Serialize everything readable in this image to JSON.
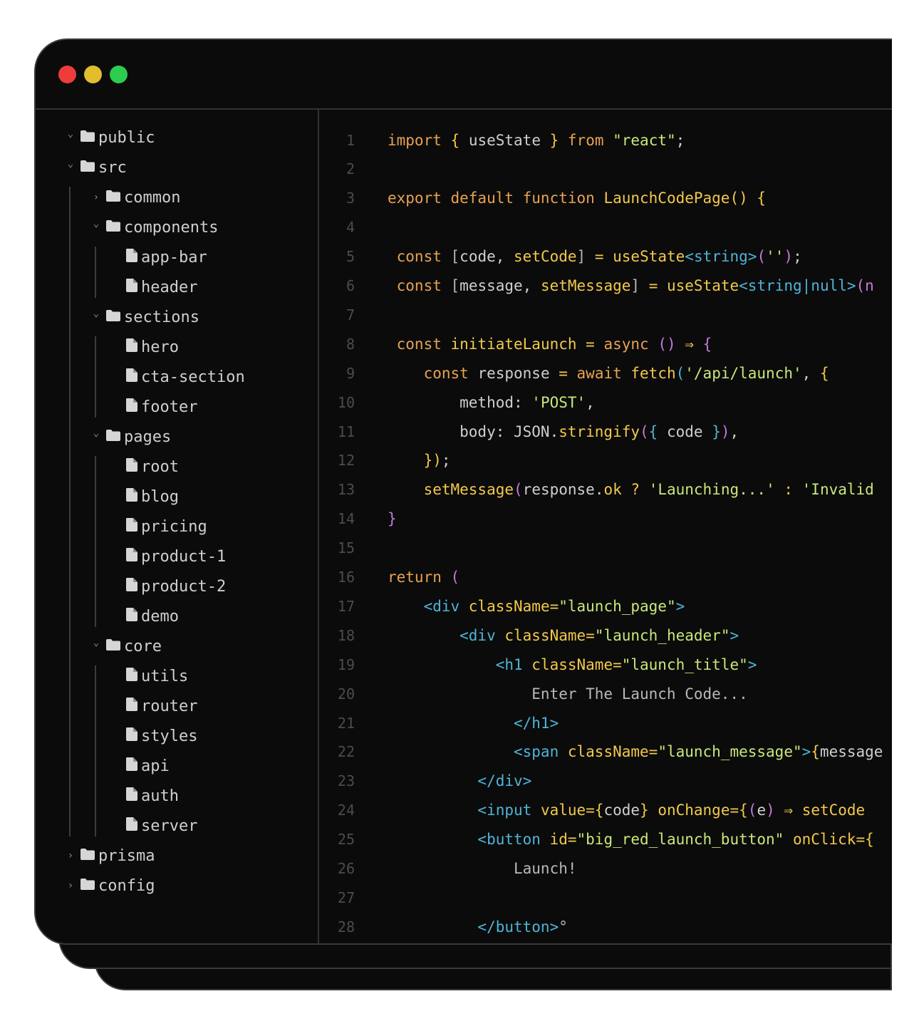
{
  "window": {
    "controls": [
      "close",
      "minimize",
      "maximize"
    ]
  },
  "tree": [
    {
      "label": "public",
      "type": "folder",
      "chevron": "down"
    },
    {
      "label": "src",
      "type": "folder",
      "chevron": "down"
    },
    {
      "label": "common",
      "type": "folder",
      "chevron": "right"
    },
    {
      "label": "components",
      "type": "folder",
      "chevron": "down"
    },
    {
      "label": "app-bar",
      "type": "file"
    },
    {
      "label": "header",
      "type": "file"
    },
    {
      "label": "sections",
      "type": "folder",
      "chevron": "down"
    },
    {
      "label": "hero",
      "type": "file"
    },
    {
      "label": "cta-section",
      "type": "file"
    },
    {
      "label": "footer",
      "type": "file"
    },
    {
      "label": "pages",
      "type": "folder",
      "chevron": "down"
    },
    {
      "label": "root",
      "type": "file"
    },
    {
      "label": "blog",
      "type": "file"
    },
    {
      "label": "pricing",
      "type": "file"
    },
    {
      "label": "product-1",
      "type": "file"
    },
    {
      "label": "product-2",
      "type": "file"
    },
    {
      "label": "demo",
      "type": "file"
    },
    {
      "label": "core",
      "type": "folder",
      "chevron": "down"
    },
    {
      "label": "utils",
      "type": "file"
    },
    {
      "label": "router",
      "type": "file"
    },
    {
      "label": "styles",
      "type": "file"
    },
    {
      "label": "api",
      "type": "file"
    },
    {
      "label": "auth",
      "type": "file"
    },
    {
      "label": "server",
      "type": "file"
    },
    {
      "label": "prisma",
      "type": "folder",
      "chevron": "right"
    },
    {
      "label": "config",
      "type": "folder",
      "chevron": "right"
    }
  ],
  "editor": {
    "line_numbers": [
      "1",
      "2",
      "3",
      "4",
      "5",
      "6",
      "7",
      "8",
      "9",
      "10",
      "11",
      "12",
      "13",
      "14",
      "15",
      "16",
      "17",
      "18",
      "19",
      "20",
      "21",
      "22",
      "23",
      "24",
      "25",
      "26",
      "27",
      "28"
    ],
    "lines": [
      [
        [
          "kw",
          "import "
        ],
        [
          "br1",
          "{ "
        ],
        [
          "id",
          "useState "
        ],
        [
          "br1",
          "} "
        ],
        [
          "kw",
          "from "
        ],
        [
          "str",
          "\"react\""
        ],
        [
          "pun",
          ";"
        ]
      ],
      [],
      [
        [
          "kw",
          "export default function "
        ],
        [
          "fn",
          "LaunchCodePage"
        ],
        [
          "br1",
          "() {"
        ]
      ],
      [],
      [
        [
          "kw",
          " const "
        ],
        [
          "brk",
          "["
        ],
        [
          "id",
          "code, "
        ],
        [
          "fn",
          "setCode"
        ],
        [
          "brk",
          "]"
        ],
        [
          "op",
          " = "
        ],
        [
          "fn",
          "useState"
        ],
        [
          "ty",
          "<string>"
        ],
        [
          "br2",
          "("
        ],
        [
          "str",
          "''"
        ],
        [
          "br2",
          ")"
        ],
        [
          "pun",
          ";"
        ]
      ],
      [
        [
          "kw",
          " const "
        ],
        [
          "brk",
          "["
        ],
        [
          "id",
          "message, "
        ],
        [
          "fn",
          "setMessage"
        ],
        [
          "brk",
          "]"
        ],
        [
          "op",
          " = "
        ],
        [
          "fn",
          "useState"
        ],
        [
          "ty",
          "<string|null>"
        ],
        [
          "br2",
          "(n"
        ]
      ],
      [],
      [
        [
          "kw",
          " const "
        ],
        [
          "fn",
          "initiateLaunch"
        ],
        [
          "op",
          " = "
        ],
        [
          "kw",
          "async "
        ],
        [
          "br2",
          "() "
        ],
        [
          "op",
          "⇒ "
        ],
        [
          "br2",
          "{"
        ]
      ],
      [
        [
          "kw",
          "    const "
        ],
        [
          "id",
          "response "
        ],
        [
          "op",
          "= "
        ],
        [
          "kw",
          "await "
        ],
        [
          "fn",
          "fetch"
        ],
        [
          "br3",
          "("
        ],
        [
          "str",
          "'/api/launch'"
        ],
        [
          "pun",
          ", "
        ],
        [
          "br1",
          "{"
        ]
      ],
      [
        [
          "id",
          "        method: "
        ],
        [
          "str",
          "'POST'"
        ],
        [
          "pun",
          ","
        ]
      ],
      [
        [
          "id",
          "        body: JSON."
        ],
        [
          "fn",
          "stringify"
        ],
        [
          "br2",
          "("
        ],
        [
          "br3",
          "{ "
        ],
        [
          "id",
          "code "
        ],
        [
          "br3",
          "}"
        ],
        [
          "br2",
          ")"
        ],
        [
          "pun",
          ","
        ]
      ],
      [
        [
          "br1",
          "    })"
        ],
        [
          "pun",
          ";"
        ]
      ],
      [
        [
          "fn",
          "    setMessage"
        ],
        [
          "br2",
          "("
        ],
        [
          "id",
          "response."
        ],
        [
          "fn",
          "ok "
        ],
        [
          "op",
          "? "
        ],
        [
          "str",
          "'Launching...' "
        ],
        [
          "op",
          ": "
        ],
        [
          "str",
          "'Invalid"
        ]
      ],
      [
        [
          "br2",
          "}"
        ]
      ],
      [],
      [
        [
          "kw",
          "return "
        ],
        [
          "br2",
          "("
        ]
      ],
      [
        [
          "tag",
          "    <div "
        ],
        [
          "attr",
          "className="
        ],
        [
          "str",
          "\"launch_page\""
        ],
        [
          "tag",
          ">"
        ]
      ],
      [
        [
          "tag",
          "        <div "
        ],
        [
          "attr",
          "className="
        ],
        [
          "str",
          "\"launch_header\""
        ],
        [
          "tag",
          ">"
        ]
      ],
      [
        [
          "tag",
          "            <h1 "
        ],
        [
          "attr",
          "className="
        ],
        [
          "str",
          "\"launch_title\""
        ],
        [
          "tag",
          ">"
        ]
      ],
      [
        [
          "txt",
          "                Enter The Launch Code..."
        ]
      ],
      [
        [
          "tag",
          "              </h1>"
        ]
      ],
      [
        [
          "tag",
          "              <span "
        ],
        [
          "attr",
          "className="
        ],
        [
          "str",
          "\"launch_message\""
        ],
        [
          "tag",
          ">"
        ],
        [
          "br1",
          "{"
        ],
        [
          "id",
          "message"
        ]
      ],
      [
        [
          "tag",
          "          </div>"
        ]
      ],
      [
        [
          "tag",
          "          <input "
        ],
        [
          "attr",
          "value="
        ],
        [
          "br1",
          "{"
        ],
        [
          "id",
          "code"
        ],
        [
          "br1",
          "} "
        ],
        [
          "attr",
          "onChange="
        ],
        [
          "br1",
          "{"
        ],
        [
          "br2",
          "("
        ],
        [
          "id",
          "e"
        ],
        [
          "br2",
          ") "
        ],
        [
          "op",
          "⇒ "
        ],
        [
          "fn",
          "setCode"
        ]
      ],
      [
        [
          "tag",
          "          <button "
        ],
        [
          "attr",
          "id="
        ],
        [
          "str",
          "\"big_red_launch_button\" "
        ],
        [
          "attr",
          "onClick="
        ],
        [
          "br1",
          "{"
        ]
      ],
      [
        [
          "txt",
          "              Launch!"
        ]
      ],
      [],
      [
        [
          "tag",
          "          </button>"
        ],
        [
          "txt",
          "°"
        ]
      ]
    ]
  }
}
